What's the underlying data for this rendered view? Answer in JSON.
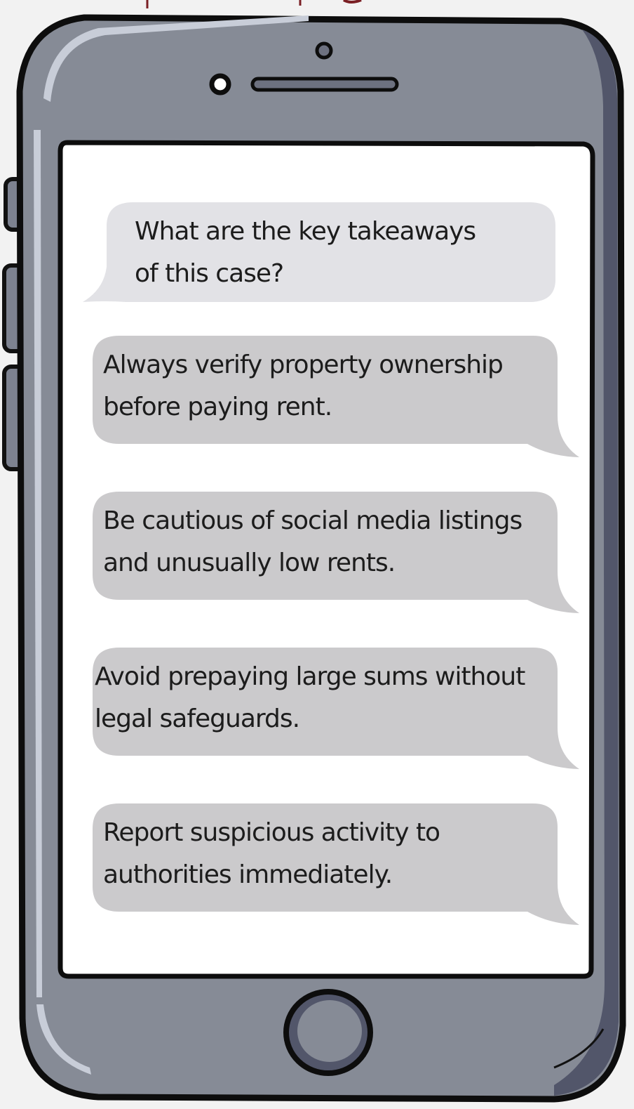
{
  "conversation": {
    "question": "What are the key takeaways\nof this case?",
    "answers": [
      "Always verify property ownership\nbefore paying rent.",
      "Be cautious of social media listings\nand unusually low rents.",
      "Avoid prepaying large sums without\nlegal safeguards.",
      "Report suspicious activity to\nauthorities immediately."
    ]
  },
  "colors": {
    "phone_body": "#868b96",
    "phone_shadow": "#52566a",
    "screen": "#ffffff",
    "question_bubble": "#e2e2e6",
    "answer_bubble": "#cbcacc",
    "text": "#1c1c1c"
  },
  "icons": [
    "front-camera-icon",
    "speaker-grille-icon",
    "home-button-icon"
  ]
}
